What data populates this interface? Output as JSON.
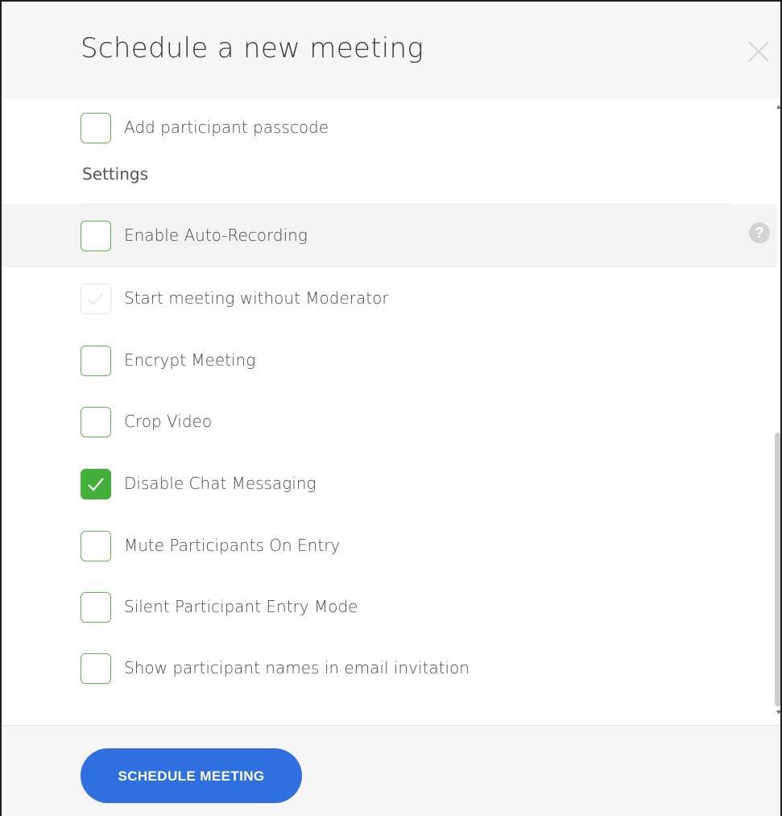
{
  "dialog": {
    "title": "Schedule a new meeting",
    "close_icon": "close-icon"
  },
  "options_top": [
    {
      "label": "Add participant passcode",
      "checked": false
    }
  ],
  "settings": {
    "section_label": "Settings",
    "help_icon": "question-icon",
    "items": [
      {
        "label": "Enable Auto-Recording",
        "checked": false,
        "disabled": false
      },
      {
        "label": "Start meeting without Moderator",
        "checked": true,
        "disabled": true
      },
      {
        "label": "Encrypt Meeting",
        "checked": false,
        "disabled": false
      },
      {
        "label": "Crop Video",
        "checked": false,
        "disabled": false
      },
      {
        "label": "Disable Chat Messaging",
        "checked": true,
        "disabled": false
      },
      {
        "label": "Mute Participants On Entry",
        "checked": false,
        "disabled": false
      },
      {
        "label": "Silent Participant Entry Mode",
        "checked": false,
        "disabled": false
      },
      {
        "label": "Show participant names in email invitation",
        "checked": false,
        "disabled": false
      }
    ]
  },
  "footer": {
    "schedule_label": "SCHEDULE MEETING"
  },
  "colors": {
    "accent_green": "#43b03b",
    "primary_blue": "#2f6fe0"
  }
}
